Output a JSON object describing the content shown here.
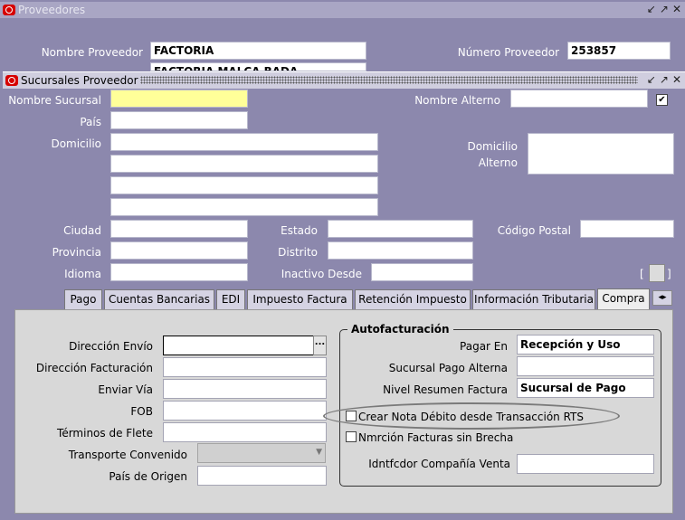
{
  "outer_window": {
    "title": "Proveedores",
    "fields": {
      "nombre_proveedor_label": "Nombre Proveedor",
      "nombre_proveedor_value": "FACTORIA",
      "numero_proveedor_label": "Número Proveedor",
      "numero_proveedor_value": "253857",
      "second_line_partial": "FACTORIA MALCA BADA"
    }
  },
  "inner_window": {
    "title": "Sucursales Proveedor",
    "labels": {
      "nombre_sucursal": "Nombre Sucursal",
      "nombre_alterno": "Nombre Alterno",
      "pais": "País",
      "domicilio": "Domicilio",
      "domicilio_alterno_1": "Domicilio",
      "domicilio_alterno_2": "Alterno",
      "ciudad": "Ciudad",
      "estado": "Estado",
      "codigo_postal": "Código Postal",
      "provincia": "Provincia",
      "distrito": "Distrito",
      "idioma": "Idioma",
      "inactivo_desde": "Inactivo Desde",
      "flex_bracket": "["
    },
    "checkmark": "✔"
  },
  "tabs": [
    {
      "label": "Pago"
    },
    {
      "label": "Cuentas Bancarias"
    },
    {
      "label": "EDI"
    },
    {
      "label": "Impuesto Factura"
    },
    {
      "label": "Retención Impuesto"
    },
    {
      "label": "Información Tributaria"
    },
    {
      "label": "Compra",
      "active": true
    }
  ],
  "compra": {
    "direccion_envio": "Dirección Envío",
    "direccion_facturacion": "Dirección Facturación",
    "enviar_via": "Enviar Vía",
    "fob": "FOB",
    "terminos_flete": "Términos de Flete",
    "transporte_convenido": "Transporte Convenido",
    "pais_origen": "País de Origen",
    "lov_button": "..."
  },
  "autofacturacion": {
    "title": "Autofacturación",
    "pagar_en_label": "Pagar En",
    "pagar_en_value": "Recepción y Uso",
    "sucursal_pago_alterna": "Sucursal Pago Alterna",
    "nivel_resumen_label": "Nivel Resumen Factura",
    "nivel_resumen_value": "Sucursal de Pago",
    "crear_nota": "Crear Nota Débito desde Transacción RTS",
    "nmrcion": "Nmrción Facturas sin Brecha",
    "idntfcdor": "Idntfcdor Compañía Venta"
  },
  "colors": {
    "background": "#8c88ad",
    "required": "#ffff99",
    "panel": "#d8d8d8"
  }
}
